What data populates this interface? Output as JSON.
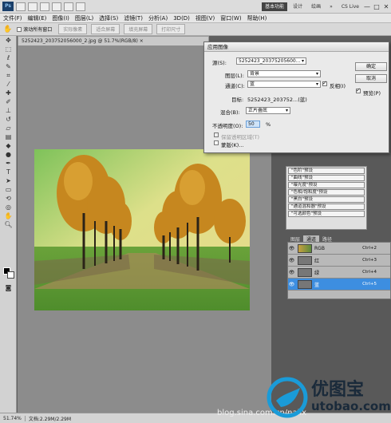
{
  "app_bar": {
    "logo": "Ps",
    "workspaces": [
      "基本功能",
      "设计",
      "绘画",
      "»"
    ],
    "cs_live": "CS Live",
    "window_controls": [
      "—",
      "□",
      "✕"
    ]
  },
  "menu": [
    "文件(F)",
    "编辑(E)",
    "图像(I)",
    "图层(L)",
    "选择(S)",
    "滤镜(T)",
    "分析(A)",
    "3D(D)",
    "视图(V)",
    "窗口(W)",
    "帮助(H)"
  ],
  "options": {
    "scroll_all": "滚动所有窗口",
    "actual_pixels": "实际像素",
    "fit_screen": "适合屏幕",
    "fill_screen": "填充屏幕",
    "print_size": "打印尺寸"
  },
  "document": {
    "tab": "5252423_203752056000_2.jpg @ 51.7%(RGB/8) ×"
  },
  "dialog": {
    "title": "应用图像",
    "source_label": "源(S):",
    "source_value": "5252423_20375205600...",
    "layer_label": "图层(L):",
    "layer_value": "背景",
    "channel_label": "通道(C):",
    "channel_value": "蓝",
    "invert_label": "反相(I)",
    "target_label": "目标:",
    "target_value": "5252423_203752...(蓝)",
    "blending_label": "混合(B):",
    "blending_value": "正片叠底",
    "opacity_label": "不透明度(O):",
    "opacity_value": "50",
    "opacity_unit": "%",
    "preserve_label": "保留透明区域(T)",
    "mask_label": "蒙版(K)...",
    "ok": "确定",
    "cancel": "取消",
    "preview_label": "预览(P)"
  },
  "adjust_presets": [
    "\"色阶\"预设",
    "\"曲线\"预设",
    "\"曝光度\"预设",
    "\"色相/饱和度\"预设",
    "\"黑白\"预设",
    "\"通道混和器\"预设",
    "\"可选颜色\"预设"
  ],
  "panel_tabs": [
    "图层",
    "通道",
    "路径"
  ],
  "channels": [
    {
      "name": "RGB",
      "key": "Ctrl+2"
    },
    {
      "name": "红",
      "key": "Ctrl+3"
    },
    {
      "name": "绿",
      "key": "Ctrl+4"
    },
    {
      "name": "蓝",
      "key": "Ctrl+5"
    }
  ],
  "status": {
    "zoom": "51.74%",
    "doc": "文档:2.29M/2.29M"
  },
  "watermark": {
    "site": "blog.sina.com.cn/nailx",
    "cn": "优图宝",
    "en": "utobao.com"
  },
  "colors": {
    "accent": "#3d8ee0",
    "canvas": "#8c8c8c"
  }
}
